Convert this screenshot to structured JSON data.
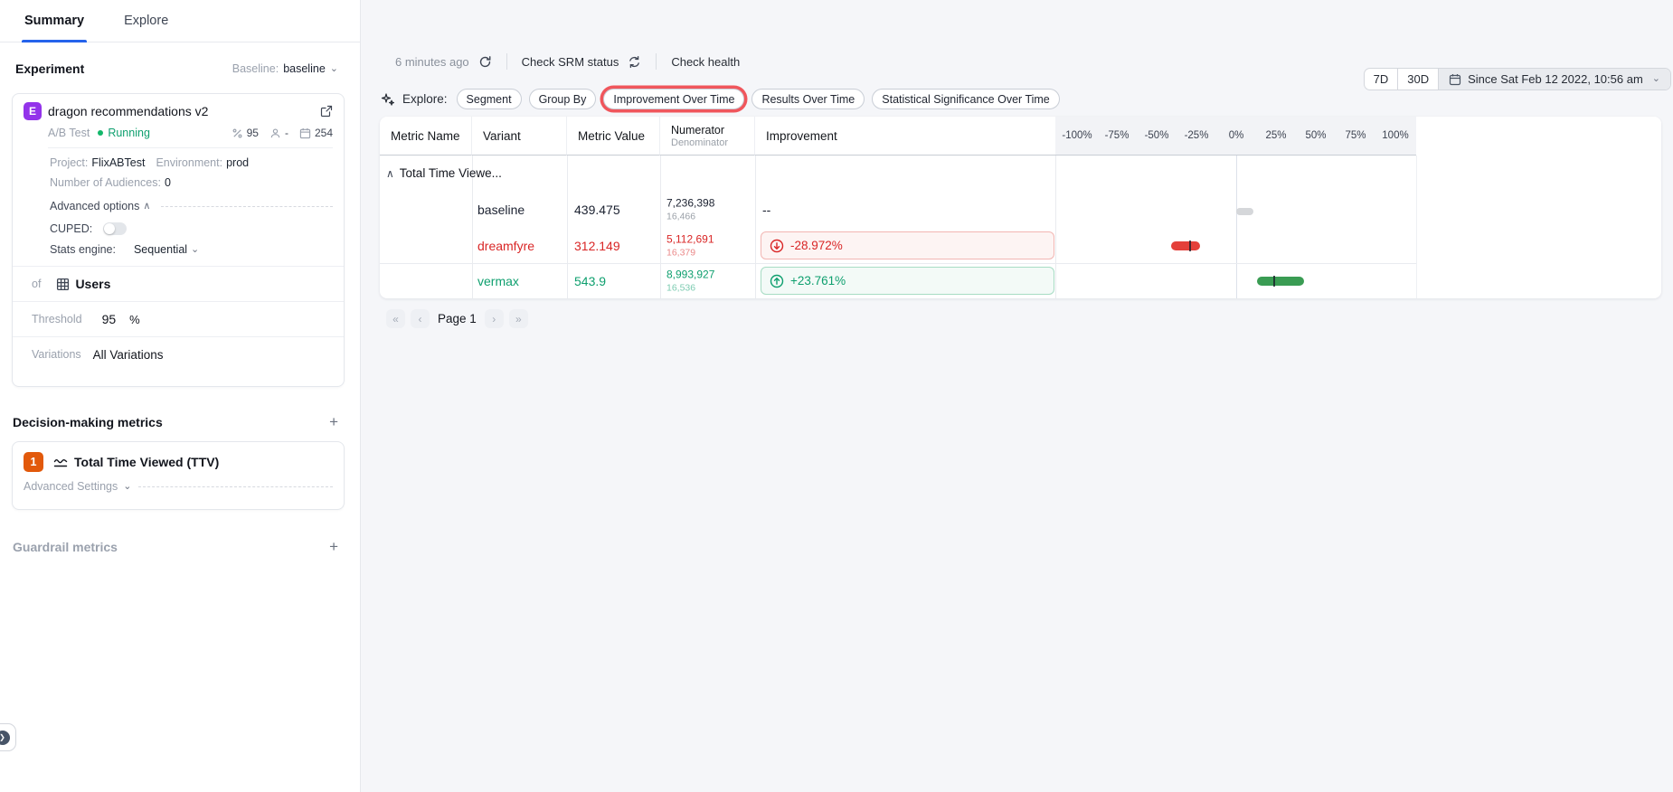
{
  "tabs": {
    "summary": "Summary",
    "explore": "Explore"
  },
  "sidebar": {
    "experiment_heading": "Experiment",
    "baseline_label": "Baseline:",
    "baseline_value": "baseline",
    "card": {
      "badge": "E",
      "title": "dragon recommendations v2",
      "type": "A/B Test",
      "status": "Running",
      "stat_percent": "95",
      "stat_users": "-",
      "stat_days": "254",
      "project_label": "Project:",
      "project": "FlixABTest",
      "environment_label": "Environment:",
      "environment": "prod",
      "audiences_label": "Number of Audiences:",
      "audiences": "0",
      "advanced_options_label": "Advanced options",
      "cuped_label": "CUPED:",
      "stats_engine_label": "Stats engine:",
      "stats_engine_value": "Sequential",
      "of_label": "of",
      "unit_type": "Users",
      "threshold_label": "Threshold",
      "threshold_value": "95",
      "threshold_unit": "%",
      "variations_label": "Variations",
      "variations_value": "All Variations"
    },
    "decision_metrics_heading": "Decision-making metrics",
    "metric_card": {
      "badge": "1",
      "title": "Total Time Viewed (TTV)",
      "advanced_settings_label": "Advanced Settings"
    },
    "guardrail_heading": "Guardrail metrics"
  },
  "toolbar": {
    "last_updated": "6 minutes ago",
    "check_srm": "Check SRM status",
    "check_health": "Check health",
    "range_7d": "7D",
    "range_30d": "30D",
    "date_range": "Since Sat Feb 12 2022, 10:56 am"
  },
  "explore_bar": {
    "label": "Explore:",
    "chips": [
      "Segment",
      "Group By",
      "Improvement Over Time",
      "Results Over Time",
      "Statistical Significance Over Time"
    ],
    "highlighted_chip": "Improvement Over Time"
  },
  "table": {
    "headers": {
      "metric_name": "Metric Name",
      "variant": "Variant",
      "metric_value": "Metric Value",
      "numerator": "Numerator",
      "denominator": "Denominator",
      "improvement": "Improvement"
    },
    "group_label": "Total Time Viewe...",
    "axis_ticks": [
      "-100%",
      "-75%",
      "-50%",
      "-25%",
      "0%",
      "25%",
      "50%",
      "75%",
      "100%"
    ],
    "rows": [
      {
        "variant": "baseline",
        "metric_value": "439.475",
        "numerator": "7,236,398",
        "denominator": "16,466",
        "improvement": "--",
        "ci_low_pct": 0,
        "ci_high_pct": 11,
        "point_pct": null
      },
      {
        "variant": "dreamfyre",
        "metric_value": "312.149",
        "numerator": "5,112,691",
        "denominator": "16,379",
        "improvement": "-28.972%",
        "ci_low_pct": -41,
        "ci_high_pct": -23,
        "point_pct": -28.972
      },
      {
        "variant": "vermax",
        "metric_value": "543.9",
        "numerator": "8,993,927",
        "denominator": "16,536",
        "improvement": "+23.761%",
        "ci_low_pct": 13,
        "ci_high_pct": 43,
        "point_pct": 23.761
      }
    ]
  },
  "pagination": {
    "first": "«",
    "prev": "‹",
    "label": "Page 1",
    "next": "›",
    "last": "»"
  },
  "icons": {
    "chevron_down": "⌄",
    "chevron_up": "∧",
    "plus": "+",
    "help": "❯"
  },
  "colors": {
    "accent_blue": "#2563eb",
    "positive_green": "#0e9f6e",
    "negative_red": "#d92626",
    "badge_purple": "#9333ea",
    "badge_orange": "#e2590b",
    "running_green": "#12b76a",
    "highlight_ring": "#f0565c",
    "bar_red": "#e4403a",
    "bar_green": "#3a9c53",
    "bar_gray": "#d5d7da"
  }
}
